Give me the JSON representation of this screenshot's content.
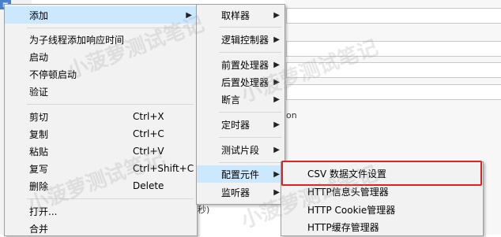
{
  "background": {
    "label_json": "on",
    "label_seconds": "秒)"
  },
  "context_menu": {
    "items": [
      {
        "label": "添加",
        "shortcut": "",
        "submenu": true,
        "highlight": true
      },
      {
        "label": "为子线程添加响应时间",
        "shortcut": ""
      },
      {
        "label": "启动",
        "shortcut": ""
      },
      {
        "label": "不停顿启动",
        "shortcut": ""
      },
      {
        "label": "验证",
        "shortcut": ""
      },
      {
        "label": "剪切",
        "shortcut": "Ctrl+X"
      },
      {
        "label": "复制",
        "shortcut": "Ctrl+C"
      },
      {
        "label": "粘贴",
        "shortcut": "Ctrl+V"
      },
      {
        "label": "复写",
        "shortcut": "Ctrl+Shift+C"
      },
      {
        "label": "删除",
        "shortcut": "Delete"
      },
      {
        "label": "打开...",
        "shortcut": ""
      },
      {
        "label": "合并",
        "shortcut": ""
      }
    ]
  },
  "add_submenu": {
    "items": [
      {
        "label": "取样器"
      },
      {
        "label": "逻辑控制器"
      },
      {
        "label": "前置处理器"
      },
      {
        "label": "后置处理器"
      },
      {
        "label": "断言"
      },
      {
        "label": "定时器"
      },
      {
        "label": "测试片段"
      },
      {
        "label": "配置元件",
        "highlight": true
      },
      {
        "label": "监听器"
      }
    ]
  },
  "config_submenu": {
    "items": [
      {
        "label": "CSV 数据文件设置"
      },
      {
        "label": "HTTP信息头管理器"
      },
      {
        "label": "HTTP Cookie管理器"
      },
      {
        "label": "HTTP缓存管理器"
      }
    ]
  },
  "watermark": {
    "text": "小菠萝测试笔记"
  },
  "colors": {
    "highlight": "#cce8ff",
    "annotation_box": "#e0211f"
  }
}
